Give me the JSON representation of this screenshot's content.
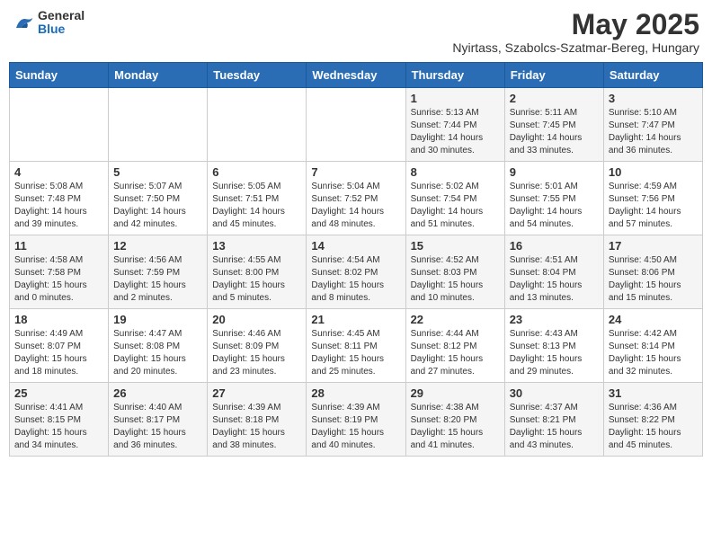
{
  "header": {
    "logo": {
      "general": "General",
      "blue": "Blue"
    },
    "title": "May 2025",
    "location": "Nyirtass, Szabolcs-Szatmar-Bereg, Hungary"
  },
  "weekdays": [
    "Sunday",
    "Monday",
    "Tuesday",
    "Wednesday",
    "Thursday",
    "Friday",
    "Saturday"
  ],
  "weeks": [
    [
      {
        "day": "",
        "info": ""
      },
      {
        "day": "",
        "info": ""
      },
      {
        "day": "",
        "info": ""
      },
      {
        "day": "",
        "info": ""
      },
      {
        "day": "1",
        "info": "Sunrise: 5:13 AM\nSunset: 7:44 PM\nDaylight: 14 hours\nand 30 minutes."
      },
      {
        "day": "2",
        "info": "Sunrise: 5:11 AM\nSunset: 7:45 PM\nDaylight: 14 hours\nand 33 minutes."
      },
      {
        "day": "3",
        "info": "Sunrise: 5:10 AM\nSunset: 7:47 PM\nDaylight: 14 hours\nand 36 minutes."
      }
    ],
    [
      {
        "day": "4",
        "info": "Sunrise: 5:08 AM\nSunset: 7:48 PM\nDaylight: 14 hours\nand 39 minutes."
      },
      {
        "day": "5",
        "info": "Sunrise: 5:07 AM\nSunset: 7:50 PM\nDaylight: 14 hours\nand 42 minutes."
      },
      {
        "day": "6",
        "info": "Sunrise: 5:05 AM\nSunset: 7:51 PM\nDaylight: 14 hours\nand 45 minutes."
      },
      {
        "day": "7",
        "info": "Sunrise: 5:04 AM\nSunset: 7:52 PM\nDaylight: 14 hours\nand 48 minutes."
      },
      {
        "day": "8",
        "info": "Sunrise: 5:02 AM\nSunset: 7:54 PM\nDaylight: 14 hours\nand 51 minutes."
      },
      {
        "day": "9",
        "info": "Sunrise: 5:01 AM\nSunset: 7:55 PM\nDaylight: 14 hours\nand 54 minutes."
      },
      {
        "day": "10",
        "info": "Sunrise: 4:59 AM\nSunset: 7:56 PM\nDaylight: 14 hours\nand 57 minutes."
      }
    ],
    [
      {
        "day": "11",
        "info": "Sunrise: 4:58 AM\nSunset: 7:58 PM\nDaylight: 15 hours\nand 0 minutes."
      },
      {
        "day": "12",
        "info": "Sunrise: 4:56 AM\nSunset: 7:59 PM\nDaylight: 15 hours\nand 2 minutes."
      },
      {
        "day": "13",
        "info": "Sunrise: 4:55 AM\nSunset: 8:00 PM\nDaylight: 15 hours\nand 5 minutes."
      },
      {
        "day": "14",
        "info": "Sunrise: 4:54 AM\nSunset: 8:02 PM\nDaylight: 15 hours\nand 8 minutes."
      },
      {
        "day": "15",
        "info": "Sunrise: 4:52 AM\nSunset: 8:03 PM\nDaylight: 15 hours\nand 10 minutes."
      },
      {
        "day": "16",
        "info": "Sunrise: 4:51 AM\nSunset: 8:04 PM\nDaylight: 15 hours\nand 13 minutes."
      },
      {
        "day": "17",
        "info": "Sunrise: 4:50 AM\nSunset: 8:06 PM\nDaylight: 15 hours\nand 15 minutes."
      }
    ],
    [
      {
        "day": "18",
        "info": "Sunrise: 4:49 AM\nSunset: 8:07 PM\nDaylight: 15 hours\nand 18 minutes."
      },
      {
        "day": "19",
        "info": "Sunrise: 4:47 AM\nSunset: 8:08 PM\nDaylight: 15 hours\nand 20 minutes."
      },
      {
        "day": "20",
        "info": "Sunrise: 4:46 AM\nSunset: 8:09 PM\nDaylight: 15 hours\nand 23 minutes."
      },
      {
        "day": "21",
        "info": "Sunrise: 4:45 AM\nSunset: 8:11 PM\nDaylight: 15 hours\nand 25 minutes."
      },
      {
        "day": "22",
        "info": "Sunrise: 4:44 AM\nSunset: 8:12 PM\nDaylight: 15 hours\nand 27 minutes."
      },
      {
        "day": "23",
        "info": "Sunrise: 4:43 AM\nSunset: 8:13 PM\nDaylight: 15 hours\nand 29 minutes."
      },
      {
        "day": "24",
        "info": "Sunrise: 4:42 AM\nSunset: 8:14 PM\nDaylight: 15 hours\nand 32 minutes."
      }
    ],
    [
      {
        "day": "25",
        "info": "Sunrise: 4:41 AM\nSunset: 8:15 PM\nDaylight: 15 hours\nand 34 minutes."
      },
      {
        "day": "26",
        "info": "Sunrise: 4:40 AM\nSunset: 8:17 PM\nDaylight: 15 hours\nand 36 minutes."
      },
      {
        "day": "27",
        "info": "Sunrise: 4:39 AM\nSunset: 8:18 PM\nDaylight: 15 hours\nand 38 minutes."
      },
      {
        "day": "28",
        "info": "Sunrise: 4:39 AM\nSunset: 8:19 PM\nDaylight: 15 hours\nand 40 minutes."
      },
      {
        "day": "29",
        "info": "Sunrise: 4:38 AM\nSunset: 8:20 PM\nDaylight: 15 hours\nand 41 minutes."
      },
      {
        "day": "30",
        "info": "Sunrise: 4:37 AM\nSunset: 8:21 PM\nDaylight: 15 hours\nand 43 minutes."
      },
      {
        "day": "31",
        "info": "Sunrise: 4:36 AM\nSunset: 8:22 PM\nDaylight: 15 hours\nand 45 minutes."
      }
    ]
  ]
}
